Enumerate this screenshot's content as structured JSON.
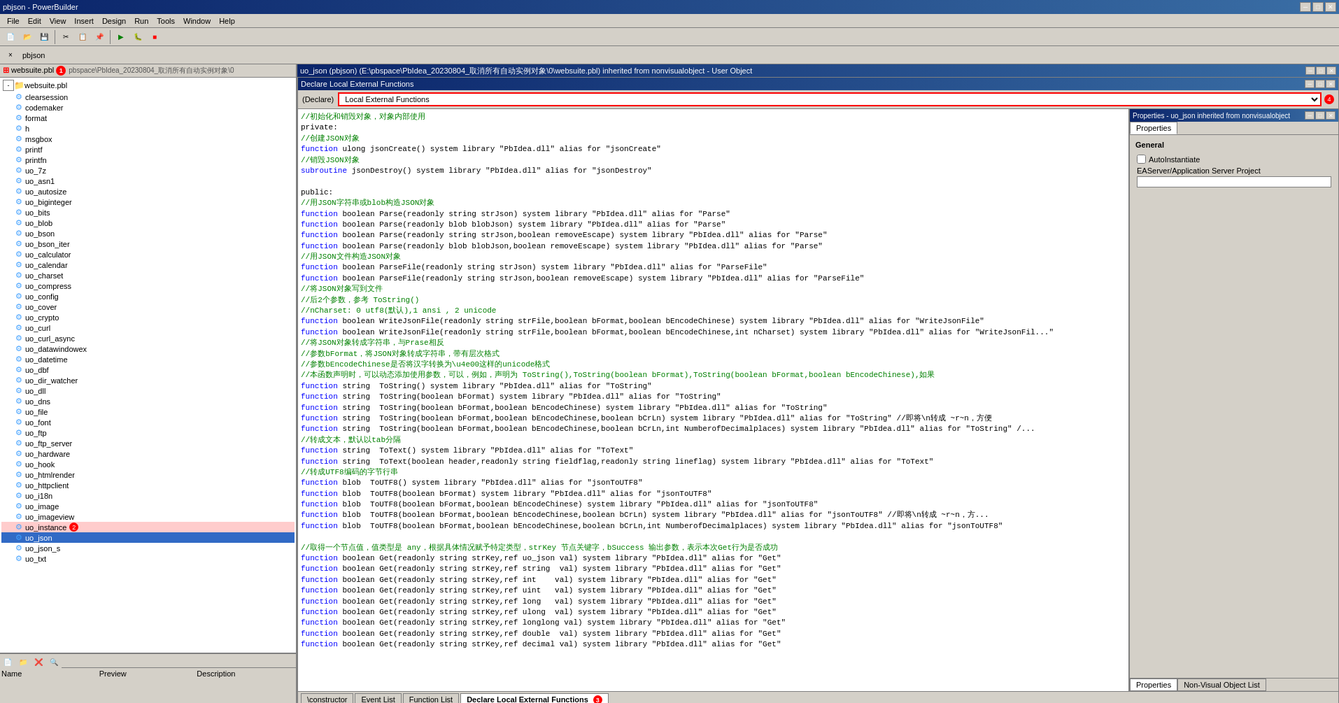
{
  "app": {
    "title": "pbjson - PowerBuilder",
    "menu_items": [
      "File",
      "Edit",
      "View",
      "Insert",
      "Design",
      "Run",
      "Tools",
      "Window",
      "Help"
    ]
  },
  "left_panel": {
    "header": "websuite.pbl (1)",
    "tree_path": "pbspace\\PbIdea_20230804_取消所有自动实例对象\\0",
    "items": [
      {
        "label": "clearsession",
        "indent": 2,
        "type": "obj"
      },
      {
        "label": "codemaker",
        "indent": 2,
        "type": "obj"
      },
      {
        "label": "format",
        "indent": 2,
        "type": "obj"
      },
      {
        "label": "h",
        "indent": 2,
        "type": "obj"
      },
      {
        "label": "msgbox",
        "indent": 2,
        "type": "obj"
      },
      {
        "label": "printf",
        "indent": 2,
        "type": "obj"
      },
      {
        "label": "printfn",
        "indent": 2,
        "type": "obj"
      },
      {
        "label": "uo_7z",
        "indent": 2,
        "type": "obj"
      },
      {
        "label": "uo_asn1",
        "indent": 2,
        "type": "obj"
      },
      {
        "label": "uo_autosize",
        "indent": 2,
        "type": "obj"
      },
      {
        "label": "uo_biginteger",
        "indent": 2,
        "type": "obj"
      },
      {
        "label": "uo_bits",
        "indent": 2,
        "type": "obj"
      },
      {
        "label": "uo_blob",
        "indent": 2,
        "type": "obj"
      },
      {
        "label": "uo_bson",
        "indent": 2,
        "type": "obj"
      },
      {
        "label": "uo_bson_iter",
        "indent": 2,
        "type": "obj"
      },
      {
        "label": "uo_calculator",
        "indent": 2,
        "type": "obj"
      },
      {
        "label": "uo_calendar",
        "indent": 2,
        "type": "obj"
      },
      {
        "label": "uo_charset",
        "indent": 2,
        "type": "obj"
      },
      {
        "label": "uo_compress",
        "indent": 2,
        "type": "obj"
      },
      {
        "label": "uo_config",
        "indent": 2,
        "type": "obj"
      },
      {
        "label": "uo_cover",
        "indent": 2,
        "type": "obj"
      },
      {
        "label": "uo_crypto",
        "indent": 2,
        "type": "obj"
      },
      {
        "label": "uo_curl",
        "indent": 2,
        "type": "obj"
      },
      {
        "label": "uo_curl_async",
        "indent": 2,
        "type": "obj"
      },
      {
        "label": "uo_datawindowex",
        "indent": 2,
        "type": "obj"
      },
      {
        "label": "uo_datetime",
        "indent": 2,
        "type": "obj"
      },
      {
        "label": "uo_dbf",
        "indent": 2,
        "type": "obj"
      },
      {
        "label": "uo_dir_watcher",
        "indent": 2,
        "type": "obj"
      },
      {
        "label": "uo_dll",
        "indent": 2,
        "type": "obj"
      },
      {
        "label": "uo_dns",
        "indent": 2,
        "type": "obj"
      },
      {
        "label": "uo_file",
        "indent": 2,
        "type": "obj"
      },
      {
        "label": "uo_font",
        "indent": 2,
        "type": "obj"
      },
      {
        "label": "uo_ftp",
        "indent": 2,
        "type": "obj"
      },
      {
        "label": "uo_ftp_server",
        "indent": 2,
        "type": "obj"
      },
      {
        "label": "uo_hardware",
        "indent": 2,
        "type": "obj"
      },
      {
        "label": "uo_hook",
        "indent": 2,
        "type": "obj"
      },
      {
        "label": "uo_htmlrender",
        "indent": 2,
        "type": "obj"
      },
      {
        "label": "uo_httpclient",
        "indent": 2,
        "type": "obj"
      },
      {
        "label": "uo_i18n",
        "indent": 2,
        "type": "obj"
      },
      {
        "label": "uo_image",
        "indent": 2,
        "type": "obj"
      },
      {
        "label": "uo_imageview",
        "indent": 2,
        "type": "obj"
      },
      {
        "label": "uo_instance",
        "indent": 2,
        "type": "obj",
        "badge": "2"
      },
      {
        "label": "uo_json",
        "indent": 2,
        "type": "obj",
        "selected": true
      },
      {
        "label": "uo_json_s",
        "indent": 2,
        "type": "obj"
      },
      {
        "label": "uo_txt",
        "indent": 2,
        "type": "obj"
      }
    ]
  },
  "inner_window": {
    "title": "uo_json (pbjson) (E:\\pbspace\\PbIdea_20230804_取消所有自动实例对象\\0\\websuite.pbl) inherited from nonvisualobject - User Object"
  },
  "declare_dialog": {
    "title": "Declare Local External Functions",
    "dropdown_label": "Local External Functions",
    "badge_4": "4",
    "code": [
      {
        "type": "comment",
        "text": "//初始化和销毁对象，对象内部使用"
      },
      {
        "type": "normal",
        "text": "private:"
      },
      {
        "type": "comment",
        "text": "//创建JSON对象"
      },
      {
        "type": "function",
        "text": "function ulong jsonCreate() system library \"PbIdea.dll\" alias for \"jsonCreate\""
      },
      {
        "type": "comment",
        "text": "//销毁JSON对象"
      },
      {
        "type": "function",
        "text": "subroutine jsonDestroy() system library \"PbIdea.dll\" alias for \"jsonDestroy\""
      },
      {
        "type": "blank",
        "text": ""
      },
      {
        "type": "normal",
        "text": "public:"
      },
      {
        "type": "comment",
        "text": "//用JSON字符串或blob构造JSON对象"
      },
      {
        "type": "function",
        "text": "function boolean Parse(readonly string strJson) system library \"PbIdea.dll\" alias for \"Parse\""
      },
      {
        "type": "function",
        "text": "function boolean Parse(readonly blob blobJson) system library \"PbIdea.dll\" alias for \"Parse\""
      },
      {
        "type": "function",
        "text": "function boolean Parse(readonly string strJson,boolean removeEscape) system library \"PbIdea.dll\" alias for \"Parse\""
      },
      {
        "type": "function",
        "text": "function boolean Parse(readonly blob blobJson,boolean removeEscape) system library \"PbIdea.dll\" alias for \"Parse\""
      },
      {
        "type": "comment",
        "text": "//用JSON文件构造JSON对象"
      },
      {
        "type": "function",
        "text": "function boolean ParseFile(readonly string strJson) system library \"PbIdea.dll\" alias for \"ParseFile\""
      },
      {
        "type": "function",
        "text": "function boolean ParseFile(readonly string strJson,boolean removeEscape) system library \"PbIdea.dll\" alias for \"ParseFile\""
      },
      {
        "type": "comment",
        "text": "//将JSON对象写到文件"
      },
      {
        "type": "comment",
        "text": "//后2个参数，参考 ToString()"
      },
      {
        "type": "comment",
        "text": "//nCharset: 0 utf8(默认),1 ansi , 2 unicode"
      },
      {
        "type": "function",
        "text": "function boolean WriteJsonFile(readonly string strFile,boolean bFormat,boolean bEncodeChinese) system library \"PbIdea.dll\" alias for \"WriteJsonFile\""
      },
      {
        "type": "function",
        "text": "function boolean WriteJsonFile(readonly string strFile,boolean bFormat,boolean bEncodeChinese,int nCharset) system library \"PbIdea.dll\" alias for \"WriteJsonFil...\""
      },
      {
        "type": "comment",
        "text": "//将JSON对象转成字符串，与Prase相反"
      },
      {
        "type": "comment",
        "text": "//参数bFormat，将JSON对象转成字符串，带有层次格式"
      },
      {
        "type": "comment",
        "text": "//参数bEncodeChinese是否将汉字转换为\\u4e00这样的unicode格式"
      },
      {
        "type": "comment",
        "text": "//本函数声明时，可以动态添加使用参数，可以，例如，声明为 ToString(),ToString(boolean bFormat),ToString(boolean bFormat,boolean bEncodeChinese),如果"
      },
      {
        "type": "function",
        "text": "function string  ToString() system library \"PbIdea.dll\" alias for \"ToString\""
      },
      {
        "type": "function",
        "text": "function string  ToString(boolean bFormat) system library \"PbIdea.dll\" alias for \"ToString\""
      },
      {
        "type": "function",
        "text": "function string  ToString(boolean bFormat,boolean bEncodeChinese) system library \"PbIdea.dll\" alias for \"ToString\""
      },
      {
        "type": "function",
        "text": "function string  ToString(boolean bFormat,boolean bEncodeChinese,boolean bCrLn) system library \"PbIdea.dll\" alias for \"ToString\" //即将\\n转成 ~r~n，方便"
      },
      {
        "type": "function",
        "text": "function string  ToString(boolean bFormat,boolean bEncodeChinese,boolean bCrLn,int NumberofDecimalplaces) system library \"PbIdea.dll\" alias for \"ToString\" /..."
      },
      {
        "type": "comment",
        "text": "//转成文本，默认以tab分隔"
      },
      {
        "type": "function",
        "text": "function string  ToText() system library \"PbIdea.dll\" alias for \"ToText\""
      },
      {
        "type": "function",
        "text": "function string  ToText(boolean header,readonly string fieldflag,readonly string lineflag) system library \"PbIdea.dll\" alias for \"ToText\""
      },
      {
        "type": "comment",
        "text": "//转成UTF8编码的字节行串"
      },
      {
        "type": "function",
        "text": "function blob  ToUTF8() system library \"PbIdea.dll\" alias for \"jsonToUTF8\""
      },
      {
        "type": "function",
        "text": "function blob  ToUTF8(boolean bFormat) system library \"PbIdea.dll\" alias for \"jsonToUTF8\""
      },
      {
        "type": "function",
        "text": "function blob  ToUTF8(boolean bFormat,boolean bEncodeChinese) system library \"PbIdea.dll\" alias for \"jsonToUTF8\""
      },
      {
        "type": "function",
        "text": "function blob  ToUTF8(boolean bFormat,boolean bEncodeChinese,boolean bCrLn) system library \"PbIdea.dll\" alias for \"jsonToUTF8\" //即将\\n转成 ~r~n，方..."
      },
      {
        "type": "function",
        "text": "function blob  ToUTF8(boolean bFormat,boolean bEncodeChinese,boolean bCrLn,int NumberofDecimalplaces) system library \"PbIdea.dll\" alias for \"jsonToUTF8\""
      },
      {
        "type": "blank",
        "text": ""
      },
      {
        "type": "comment",
        "text": "//取得一个节点值，值类型是 any，根据具体情况赋予特定类型，strKey 节点关键字，bSuccess 输出参数，表示本次Get行为是否成功"
      },
      {
        "type": "function",
        "text": "function boolean Get(readonly string strKey,ref uo_json val) system library \"PbIdea.dll\" alias for \"Get\""
      },
      {
        "type": "function",
        "text": "function boolean Get(readonly string strKey,ref string  val) system library \"PbIdea.dll\" alias for \"Get\""
      },
      {
        "type": "function",
        "text": "function boolean Get(readonly string strKey,ref int    val) system library \"PbIdea.dll\" alias for \"Get\""
      },
      {
        "type": "function",
        "text": "function boolean Get(readonly string strKey,ref uint   val) system library \"PbIdea.dll\" alias for \"Get\""
      },
      {
        "type": "function",
        "text": "function boolean Get(readonly string strKey,ref long   val) system library \"PbIdea.dll\" alias for \"Get\""
      },
      {
        "type": "function",
        "text": "function boolean Get(readonly string strKey,ref ulong  val) system library \"PbIdea.dll\" alias for \"Get\""
      },
      {
        "type": "function",
        "text": "function boolean Get(readonly string strKey,ref longlong val) system library \"PbIdea.dll\" alias for \"Get\""
      },
      {
        "type": "function",
        "text": "function boolean Get(readonly string strKey,ref double  val) system library \"PbIdea.dll\" alias for \"Get\""
      },
      {
        "type": "function",
        "text": "function boolean Get(readonly string strKey,ref decimal val) system library \"PbIdea.dll\" alias for \"Get\""
      }
    ],
    "tabs": [
      {
        "label": "\\constructor",
        "active": false
      },
      {
        "label": "Event List",
        "active": false
      },
      {
        "label": "Function List",
        "active": false
      },
      {
        "label": "Declare Local External Functions",
        "active": true
      }
    ],
    "badge_3": "3"
  },
  "properties_panel": {
    "title": "Properties - uo_json  inherited  from  nonvisualobject",
    "tabs": [
      {
        "label": "Properties",
        "active": true
      },
      {
        "label": "Non-Visual Object List",
        "active": false
      }
    ],
    "section": "General",
    "fields": [
      {
        "label": "AutoInstantiate",
        "checked": false
      },
      {
        "label": "EAServer/Application Server Project",
        "value": ""
      }
    ]
  },
  "bottom_panel": {
    "columns": [
      "Name",
      "Preview",
      "Description"
    ]
  },
  "toolbar2_label": "pbjson",
  "close_tab_label": "×"
}
